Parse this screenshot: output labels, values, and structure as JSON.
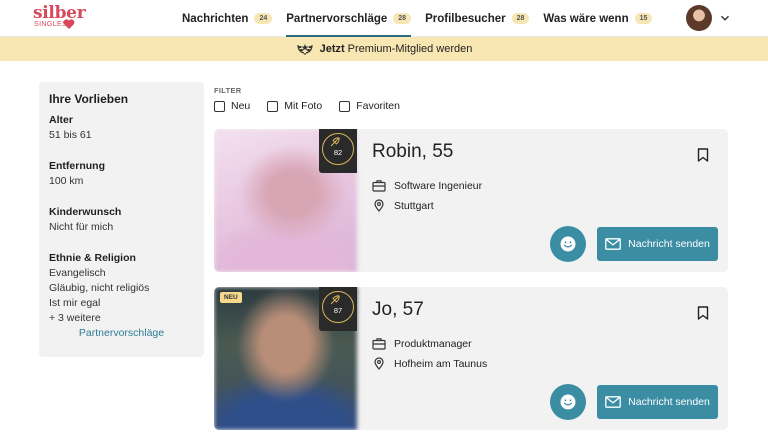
{
  "brand": {
    "name": "silber",
    "sub": "SINGLES"
  },
  "nav": [
    {
      "label": "Nachrichten",
      "count": "24"
    },
    {
      "label": "Partnervorschläge",
      "count": "28"
    },
    {
      "label": "Profilbesucher",
      "count": "28"
    },
    {
      "label": "Was wäre wenn",
      "count": "15"
    }
  ],
  "premium": {
    "strong": "Jetzt",
    "text": "Premium-Mitglied werden"
  },
  "sidebar": {
    "title": "Ihre Vorlieben",
    "groups": [
      {
        "label": "Alter",
        "values": [
          "51 bis 61"
        ]
      },
      {
        "label": "Entfernung",
        "values": [
          "100 km"
        ]
      },
      {
        "label": "Kinderwunsch",
        "values": [
          "Nicht für mich"
        ]
      },
      {
        "label": "Ethnie & Religion",
        "values": [
          "Evangelisch",
          "Gläubig, nicht religiös",
          "Ist mir egal",
          "+ 3 weitere"
        ]
      }
    ],
    "link": "Partnervorschläge"
  },
  "filter": {
    "label": "FILTER",
    "options": [
      "Neu",
      "Mit Foto",
      "Favoriten"
    ]
  },
  "cards": [
    {
      "name": "Robin, 55",
      "match": "82",
      "job": "Software Ingenieur",
      "location": "Stuttgart",
      "button": "Nachricht senden"
    },
    {
      "name": "Jo, 57",
      "badge": "NEU",
      "match": "87",
      "job": "Produktmanager",
      "location": "Hofheim am Taunus",
      "button": "Nachricht senden"
    }
  ],
  "colors": {
    "brand": "#d9475a",
    "accent": "#3b8da3",
    "premium_bg": "#f8e7b3",
    "nav_underline": "#2b6c80"
  },
  "icons": [
    "heart-icon",
    "chevron-down-icon",
    "laurel-icon",
    "bookmark-icon",
    "briefcase-icon",
    "location-pin-icon",
    "smiley-icon",
    "envelope-icon",
    "match-feather-icon"
  ]
}
